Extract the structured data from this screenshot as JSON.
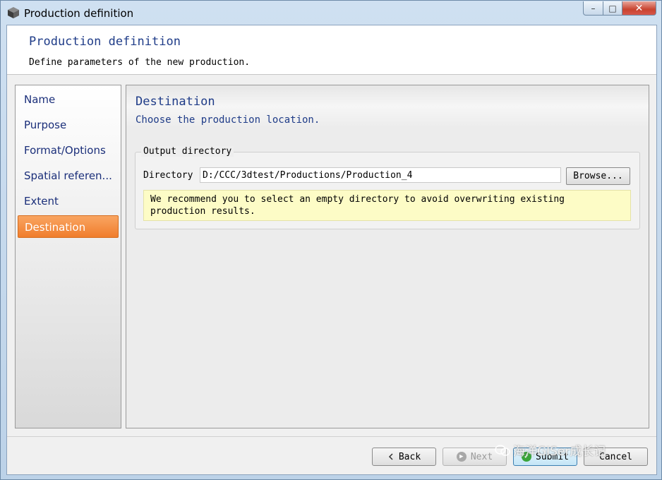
{
  "window": {
    "title": "Production definition",
    "minimize_glyph": "–",
    "maximize_glyph": "□",
    "close_glyph": "✕"
  },
  "header": {
    "title": "Production definition",
    "subtitle": "Define parameters of the new production."
  },
  "sidebar": {
    "items": [
      {
        "label": "Name",
        "active": false
      },
      {
        "label": "Purpose",
        "active": false
      },
      {
        "label": "Format/Options",
        "active": false
      },
      {
        "label": "Spatial referen...",
        "active": false
      },
      {
        "label": "Extent",
        "active": false
      },
      {
        "label": "Destination",
        "active": true
      }
    ]
  },
  "panel": {
    "title": "Destination",
    "subtitle": "Choose the production location.",
    "group_title": "Output directory",
    "directory_label": "Directory",
    "directory_value": "D:/CCC/3dtest/Productions/Production_4",
    "browse_label": "Browse...",
    "notice": "We recommend you to select an empty directory to avoid overwriting existing production results."
  },
  "footer": {
    "back_label": "Back",
    "next_label": "Next",
    "submit_label": "Submit",
    "cancel_label": "Cancel"
  },
  "watermark": {
    "text": "海洋GISer成长记"
  },
  "colors": {
    "active_item": "#f07d2c",
    "title_blue": "#1f3c88",
    "notice_bg": "#fdfcc6"
  }
}
